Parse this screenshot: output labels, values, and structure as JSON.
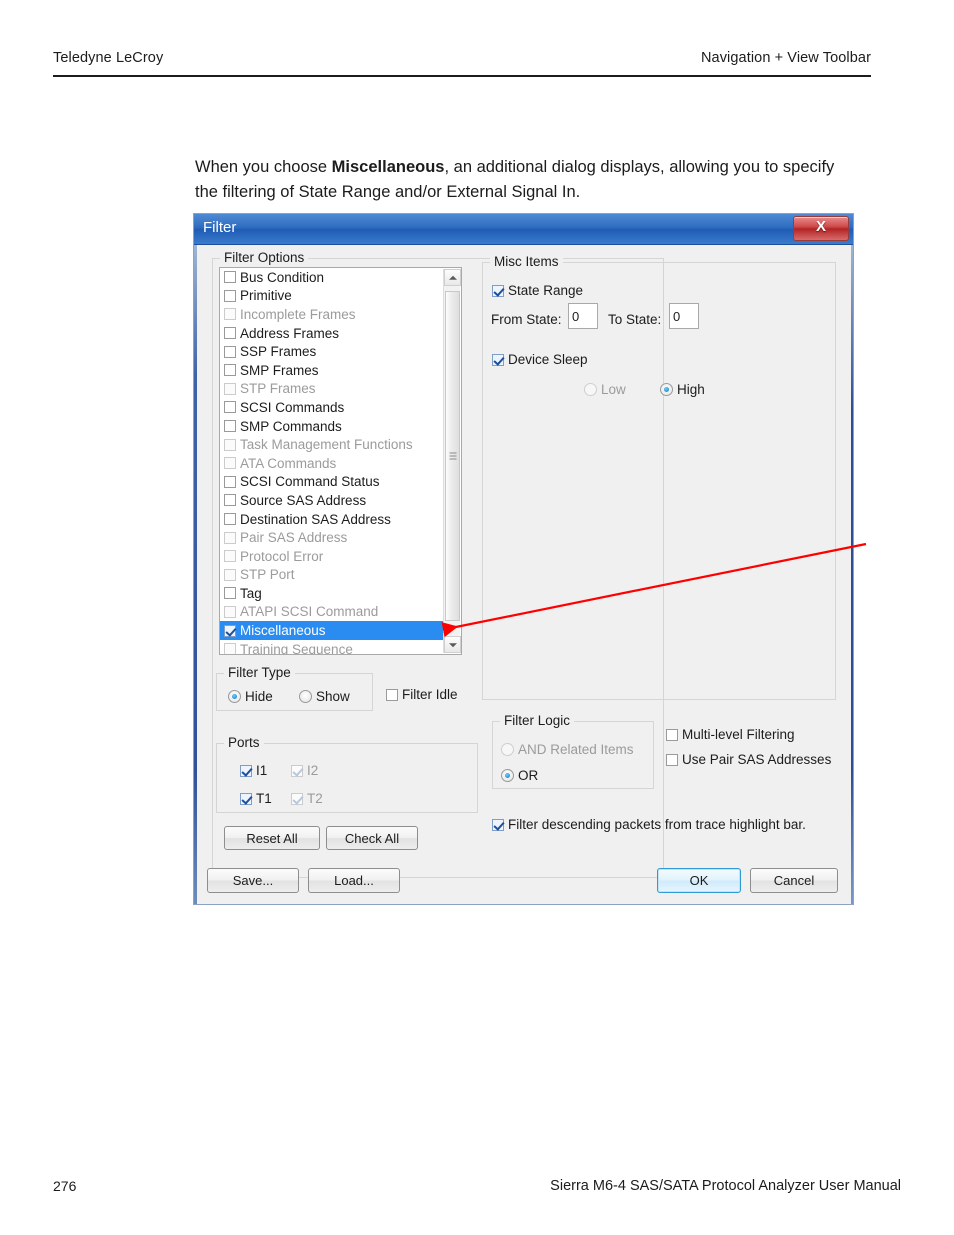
{
  "page": {
    "header_left": "Teledyne LeCroy",
    "header_right": "Navigation + View Toolbar",
    "body_text_before": "When you choose ",
    "body_text_bold": "Miscellaneous",
    "body_text_after": ", an additional dialog displays, allowing you to specify the filtering of State Range and/or External Signal In.",
    "footer_page_number": "276",
    "footer_title": "Sierra M6-4 SAS/SATA Protocol Analyzer User Manual"
  },
  "dialog": {
    "title": "Filter",
    "close_label": "X",
    "accent_color": "#2d4e96",
    "selection_color": "#2a8cf0",
    "annotation_arrow_color": "#ff0000",
    "filter_options": {
      "group_title": "Filter Options",
      "items": [
        {
          "label": "Bus Condition",
          "checked": false,
          "enabled": true,
          "selected": false
        },
        {
          "label": "Primitive",
          "checked": false,
          "enabled": true,
          "selected": false
        },
        {
          "label": "Incomplete Frames",
          "checked": false,
          "enabled": false,
          "selected": false
        },
        {
          "label": "Address Frames",
          "checked": false,
          "enabled": true,
          "selected": false
        },
        {
          "label": "SSP Frames",
          "checked": false,
          "enabled": true,
          "selected": false
        },
        {
          "label": "SMP Frames",
          "checked": false,
          "enabled": true,
          "selected": false
        },
        {
          "label": "STP Frames",
          "checked": false,
          "enabled": false,
          "selected": false
        },
        {
          "label": "SCSI Commands",
          "checked": false,
          "enabled": true,
          "selected": false
        },
        {
          "label": "SMP Commands",
          "checked": false,
          "enabled": true,
          "selected": false
        },
        {
          "label": "Task Management Functions",
          "checked": false,
          "enabled": false,
          "selected": false
        },
        {
          "label": "ATA Commands",
          "checked": false,
          "enabled": false,
          "selected": false
        },
        {
          "label": "SCSI Command Status",
          "checked": false,
          "enabled": true,
          "selected": false
        },
        {
          "label": "Source SAS Address",
          "checked": false,
          "enabled": true,
          "selected": false
        },
        {
          "label": "Destination SAS Address",
          "checked": false,
          "enabled": true,
          "selected": false
        },
        {
          "label": "Pair SAS Address",
          "checked": false,
          "enabled": false,
          "selected": false
        },
        {
          "label": "Protocol Error",
          "checked": false,
          "enabled": false,
          "selected": false
        },
        {
          "label": "STP Port",
          "checked": false,
          "enabled": false,
          "selected": false
        },
        {
          "label": "Tag",
          "checked": false,
          "enabled": true,
          "selected": false
        },
        {
          "label": "ATAPI SCSI Command",
          "checked": false,
          "enabled": false,
          "selected": false
        },
        {
          "label": "Miscellaneous",
          "checked": true,
          "enabled": true,
          "selected": true
        },
        {
          "label": "Training Sequence",
          "checked": false,
          "enabled": false,
          "selected": false
        }
      ]
    },
    "misc_items": {
      "group_title": "Misc Items",
      "state_range_label": "State Range",
      "state_range_checked": true,
      "from_state_label": "From State:",
      "from_state_value": "0",
      "to_state_label": "To State:",
      "to_state_value": "0",
      "device_sleep_label": "Device Sleep",
      "device_sleep_checked": true,
      "low_label": "Low",
      "high_label": "High",
      "selected_level": "High"
    },
    "filter_type": {
      "group_title": "Filter Type",
      "hide_label": "Hide",
      "show_label": "Show",
      "selected": "Hide"
    },
    "filter_idle": {
      "label": "Filter Idle",
      "checked": false
    },
    "ports": {
      "group_title": "Ports",
      "items": [
        {
          "label": "I1",
          "checked": true,
          "enabled": true
        },
        {
          "label": "I2",
          "checked": true,
          "enabled": false
        },
        {
          "label": "T1",
          "checked": true,
          "enabled": true
        },
        {
          "label": "T2",
          "checked": true,
          "enabled": false
        }
      ]
    },
    "filter_logic": {
      "group_title": "Filter Logic",
      "and_label": "AND Related Items",
      "or_label": "OR",
      "selected": "OR"
    },
    "multi_level_filtering": {
      "label": "Multi-level Filtering",
      "checked": false
    },
    "use_pair_sas_addresses": {
      "label": "Use Pair SAS Addresses",
      "checked": false
    },
    "filter_descending": {
      "label": "Filter descending packets from trace highlight bar.",
      "checked": true
    },
    "buttons": {
      "reset_all": "Reset All",
      "check_all": "Check All",
      "save": "Save...",
      "load": "Load...",
      "ok": "OK",
      "cancel": "Cancel"
    }
  }
}
